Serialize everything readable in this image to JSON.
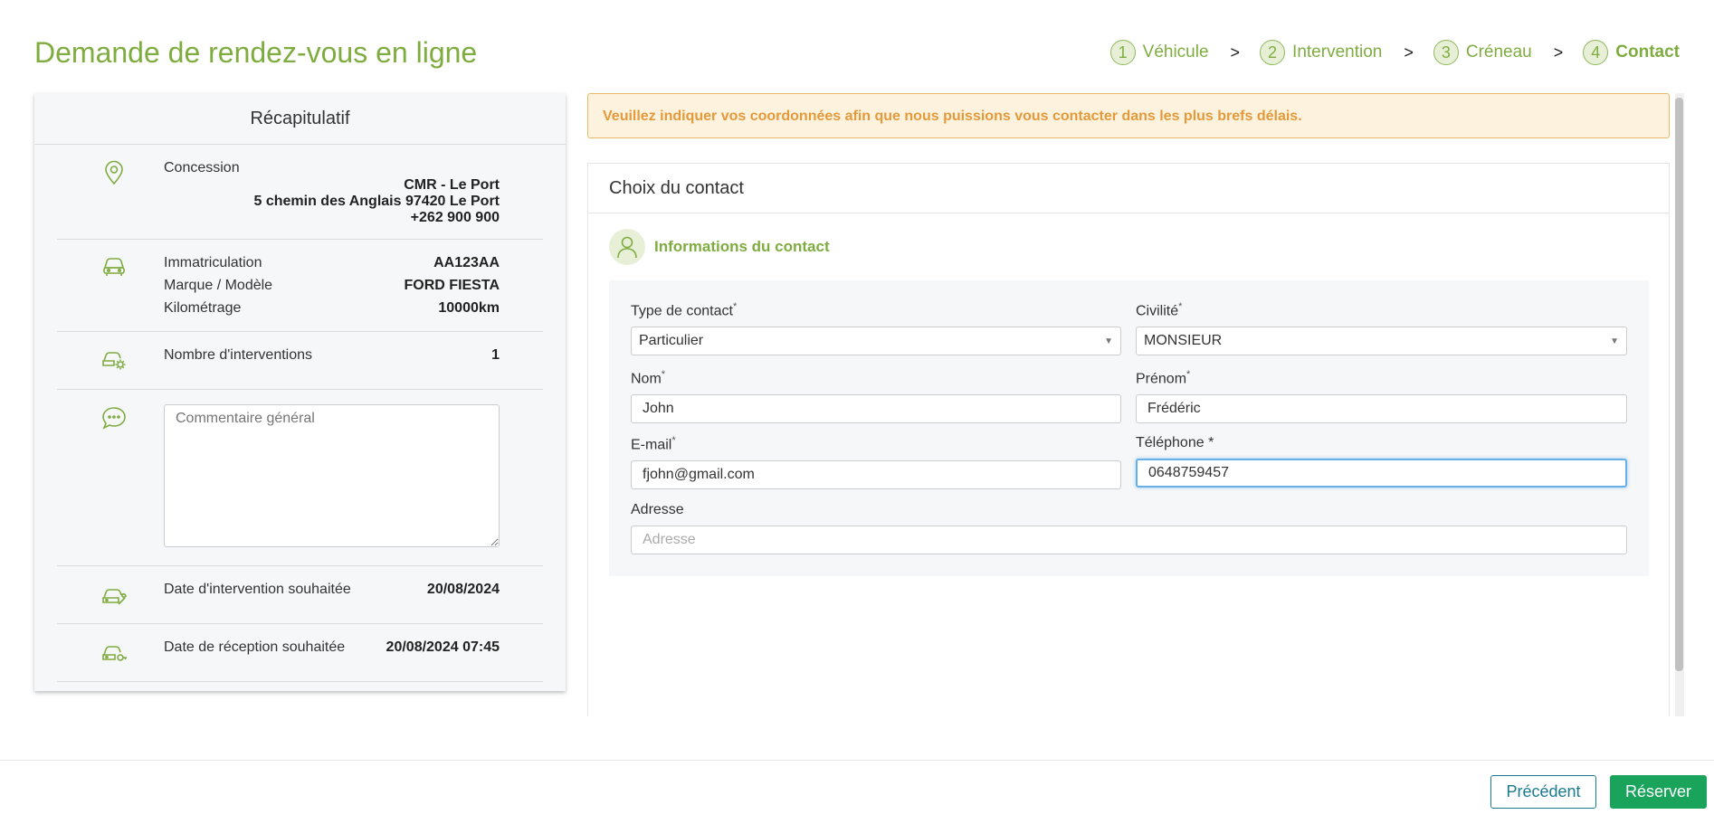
{
  "page": {
    "title": "Demande de rendez-vous en ligne"
  },
  "steps": [
    {
      "num": "1",
      "label": "Véhicule"
    },
    {
      "num": "2",
      "label": "Intervention"
    },
    {
      "num": "3",
      "label": "Créneau"
    },
    {
      "num": "4",
      "label": "Contact"
    }
  ],
  "step_separator": ">",
  "recap": {
    "title": "Récapitulatif",
    "concession_label": "Concession",
    "concession_name": "CMR - Le Port",
    "concession_address": "5 chemin des Anglais 97420 Le Port",
    "concession_phone": "+262 900 900",
    "immat_label": "Immatriculation",
    "immat_value": "AA123AA",
    "model_label": "Marque / Modèle",
    "model_value": "FORD FIESTA",
    "km_label": "Kilométrage",
    "km_value": "10000km",
    "interventions_label": "Nombre d'interventions",
    "interventions_value": "1",
    "comment_placeholder": "Commentaire général",
    "date_intervention_label": "Date d'intervention souhaitée",
    "date_intervention_value": "20/08/2024",
    "date_reception_label": "Date de réception souhaitée",
    "date_reception_value": "20/08/2024 07:45"
  },
  "alert": {
    "text": "Veuillez indiquer vos coordonnées afin que nous puissions vous contacter dans les plus brefs délais."
  },
  "contact": {
    "panel_title": "Choix du contact",
    "section_title": "Informations du contact",
    "type_label": "Type de contact",
    "type_value": "Particulier",
    "civilite_label": "Civilité",
    "civilite_value": "MONSIEUR",
    "nom_label": "Nom",
    "nom_value": "John",
    "prenom_label": "Prénom",
    "prenom_value": "Frédéric",
    "email_label": "E-mail",
    "email_value": "fjohn@gmail.com",
    "telephone_label": "Téléphone *",
    "telephone_value": "0648759457",
    "adresse_label": "Adresse",
    "adresse_placeholder": "Adresse",
    "required_mark": "*"
  },
  "footer": {
    "prev_label": "Précédent",
    "book_label": "Réserver"
  },
  "colors": {
    "accent": "#7fac3f",
    "warning_text": "#e49a3a",
    "book_button": "#1aa35a",
    "prev_button": "#1a7b8c"
  }
}
